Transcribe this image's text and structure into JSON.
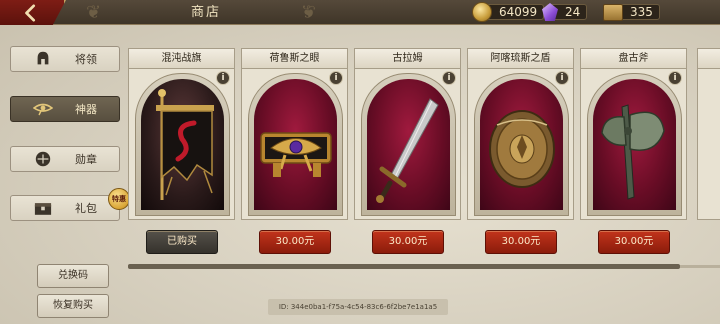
{
  "header": {
    "title": "商店"
  },
  "currencies": {
    "gold": "64099",
    "gems": "24",
    "chests": "335"
  },
  "sidebar": {
    "items": [
      {
        "label": "将领",
        "icon": "helmet-icon"
      },
      {
        "label": "神器",
        "icon": "eye-of-horus-icon"
      },
      {
        "label": "勋章",
        "icon": "medal-icon"
      },
      {
        "label": "礼包",
        "icon": "treasure-chest-icon"
      }
    ],
    "active_index": 1,
    "badge": "特惠"
  },
  "buttons": {
    "redeem_code": "兑换码",
    "restore_purchase": "恢复购买"
  },
  "cards": [
    {
      "name": "混沌战旗",
      "price": "已购买",
      "bought": true,
      "art": "chaos-banner"
    },
    {
      "name": "荷鲁斯之眼",
      "price": "30.00元",
      "bought": false,
      "art": "eye-of-horus"
    },
    {
      "name": "古拉姆",
      "price": "30.00元",
      "bought": false,
      "art": "sword"
    },
    {
      "name": "阿喀琉斯之盾",
      "price": "30.00元",
      "bought": false,
      "art": "shield"
    },
    {
      "name": "盘古斧",
      "price": "30.00元",
      "bought": false,
      "art": "axe"
    }
  ],
  "info_label": "i",
  "footer": {
    "id_text": "ID: 344e0ba1-f75a-4c54-83c6-6f2be7e1a1a5"
  }
}
